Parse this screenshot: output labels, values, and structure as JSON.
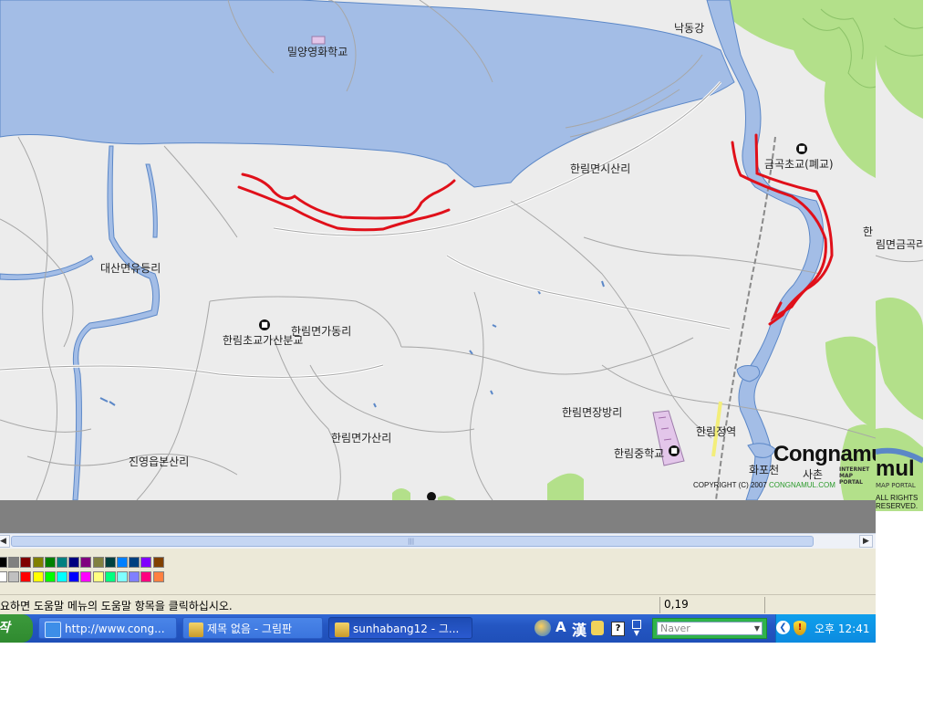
{
  "map": {
    "labels": {
      "school_milyang": "밀양영화학교",
      "river_nakdong": "낙동강",
      "school_geumgok": "금곡초교(폐교)",
      "village_sisan": "한림면시산리",
      "village_geumgok": "림면금곡리",
      "village_han": "한",
      "village_daesan": "대산면유등리",
      "school_hanlim_gasan": "한림초교가산분교",
      "village_gadong": "한림면가동리",
      "village_gasan": "한림면가산리",
      "village_jangbang": "한림면장방리",
      "station_hanlim": "한림정역",
      "school_hanlim_middle": "한림중학교",
      "village_jinyoung": "진영읍본산리",
      "stream_hwapo": "화포천",
      "village_sichon": "사촌"
    },
    "logo": {
      "brand": "Congnamul",
      "tagline": "INTERNET MAP PORTAL",
      "copyright": "COPYRIGHT (C) 2007",
      "site": "CONGNAMUL.COM",
      "rights": "ALL RIGHTS RESERVED."
    },
    "colors": {
      "land": "#ececec",
      "water": "#a3bde6",
      "water_outline": "#5b87c7",
      "forest": "#b3e08a",
      "annotation": "#e0101a"
    }
  },
  "paint": {
    "palette_top": [
      "#000000",
      "#808080",
      "#800000",
      "#808000",
      "#008000",
      "#008080",
      "#000080",
      "#800080",
      "#808040",
      "#004040",
      "#0080ff",
      "#004080",
      "#8000ff",
      "#804000"
    ],
    "palette_bottom": [
      "#ffffff",
      "#c0c0c0",
      "#ff0000",
      "#ffff00",
      "#00ff00",
      "#00ffff",
      "#0000ff",
      "#ff00ff",
      "#ffff80",
      "#00ff80",
      "#80ffff",
      "#8080ff",
      "#ff0080",
      "#ff8040"
    ],
    "status_help": "요하면 도움말 메뉴의 도움말 항목을 클릭하십시오.",
    "status_coords": "0,19"
  },
  "taskbar": {
    "start_label": "작",
    "items": [
      {
        "label": "http://www.cong..."
      },
      {
        "label": "제목 없음 - 그림판"
      },
      {
        "label": "sunhabang12 - 그..."
      }
    ],
    "toolbar_search_placeholder": "Naver",
    "clock": "오후 12:41",
    "ime_a": "A",
    "ime_han": "漢"
  }
}
